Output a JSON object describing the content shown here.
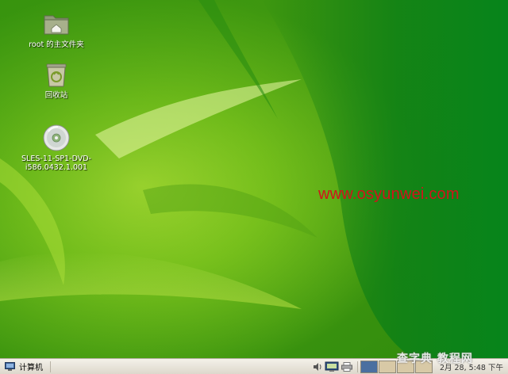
{
  "desktop": {
    "icons": [
      {
        "label": "root 的主文件夹",
        "icon": "home-folder-icon"
      },
      {
        "label": "回收站",
        "icon": "trash-icon"
      },
      {
        "label": "SLES-11-SP1-DVD-\ni586.0432.1.001",
        "icon": "dvd-disc-icon"
      }
    ],
    "watermark": "www.osyunwei.com",
    "site_stamp": "查字典 教程网"
  },
  "taskbar": {
    "start_label": "计算机",
    "start_icon": "computer-icon",
    "tray_icons": [
      "volume-icon",
      "network-icon",
      "printer-icon"
    ],
    "workspace_count": 4,
    "active_workspace": 1,
    "clock": "2月 28,  5:48 下午"
  },
  "colors": {
    "wallpaper_base": "#2f8f0d",
    "taskbar": "#e8e4d9",
    "workspace_active": "#4a6fa0",
    "workspace_inactive": "#d8c9a6",
    "watermark": "#d3121b"
  }
}
